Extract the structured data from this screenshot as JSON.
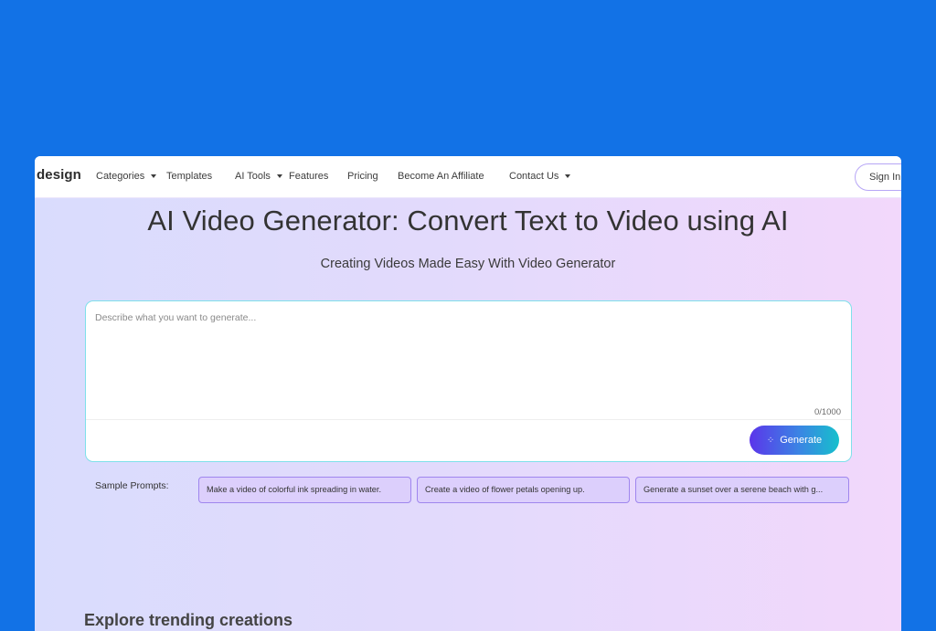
{
  "nav": {
    "logo": "design",
    "items": [
      {
        "label": "Categories",
        "dropdown": true
      },
      {
        "label": "Templates",
        "dropdown": false
      },
      {
        "label": "AI Tools",
        "dropdown": true
      },
      {
        "label": "Features",
        "dropdown": false
      },
      {
        "label": "Pricing",
        "dropdown": false
      },
      {
        "label": "Become An Affiliate",
        "dropdown": false
      },
      {
        "label": "Contact Us",
        "dropdown": true
      }
    ],
    "sign_in": "Sign In"
  },
  "hero": {
    "title": "AI Video Generator: Convert Text to Video using AI",
    "subtitle": "Creating Videos Made Easy With Video Generator"
  },
  "prompt": {
    "placeholder": "Describe what you want to generate...",
    "value": "",
    "counter": "0/1000",
    "generate_label": "Generate",
    "generate_icon": "sparkle-icon"
  },
  "samples": {
    "label": "Sample Prompts:",
    "items": [
      "Make a video of colorful ink spreading in water.",
      "Create a video of flower petals opening up.",
      "Generate a sunset over a serene beach with g..."
    ]
  },
  "explore": {
    "heading": "Explore trending creations"
  },
  "colors": {
    "desktop_bg": "#1272e6",
    "input_border": "#7fe0ea",
    "chip_bg": "#dccffc",
    "chip_border": "#9f86ee",
    "generate_gradient_start": "#5b35ea",
    "generate_gradient_end": "#16c0cc"
  }
}
